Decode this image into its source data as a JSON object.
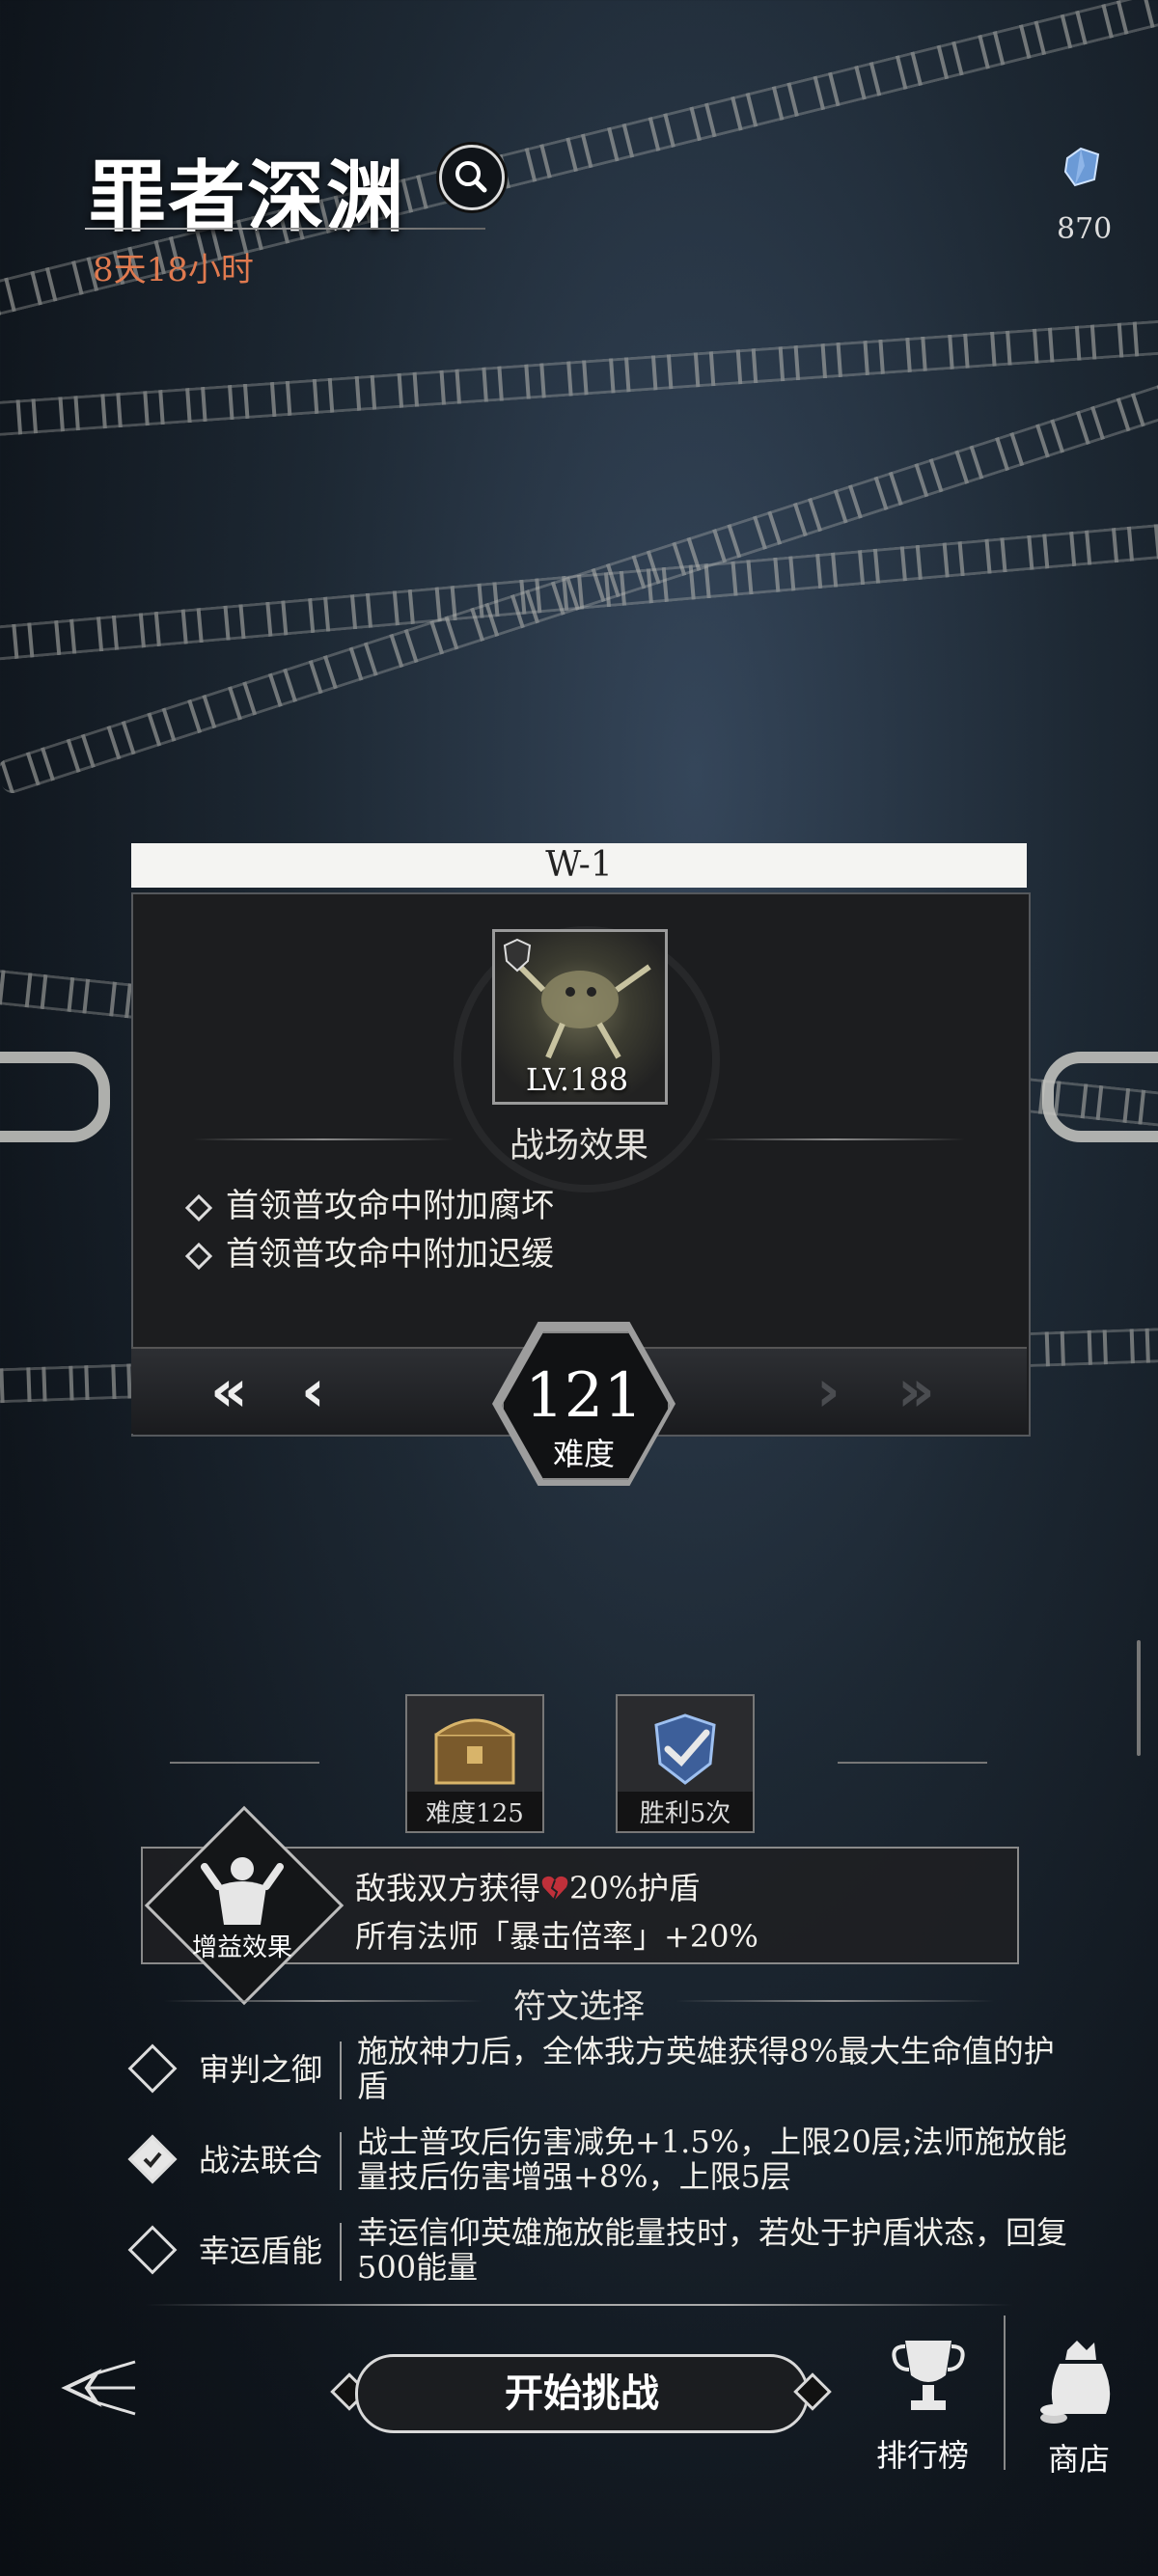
{
  "header": {
    "title": "罪者深渊",
    "timer": "8天18小时",
    "currency_count": "870",
    "currency_icon": "crystal-icon",
    "search_icon": "search-icon"
  },
  "stage": {
    "name": "W-1",
    "boss_level": "LV.188",
    "effects_title": "战场效果",
    "effects": [
      "首领普攻命中附加腐坏",
      "首领普攻命中附加迟缓"
    ],
    "difficulty_value": "121",
    "difficulty_label": "难度"
  },
  "rewards": [
    {
      "label": "难度125",
      "icon": "treasure-chest-icon"
    },
    {
      "label": "胜利5次",
      "icon": "victory-check-icon"
    }
  ],
  "buff": {
    "label": "增益效果",
    "line1_prefix": "敌我双方获得",
    "line1_suffix": "20%护盾",
    "line2": "所有法师「暴击倍率」+20%"
  },
  "runes": {
    "title": "符文选择",
    "items": [
      {
        "name": "审判之御",
        "checked": false,
        "desc": "施放神力后，全体我方英雄获得8%最大生命值的护盾"
      },
      {
        "name": "战法联合",
        "checked": true,
        "desc": "战士普攻后伤害减免+1.5%，上限20层;法师施放能量技后伤害增强+8%，上限5层"
      },
      {
        "name": "幸运盾能",
        "checked": false,
        "desc": "幸运信仰英雄施放能量技时，若处于护盾状态，回复500能量"
      }
    ]
  },
  "bottom": {
    "start_button": "开始挑战",
    "rank_label": "排行榜",
    "shop_label": "商店"
  },
  "colors": {
    "timer": "#e07a4f",
    "heart": "#c0303a"
  }
}
